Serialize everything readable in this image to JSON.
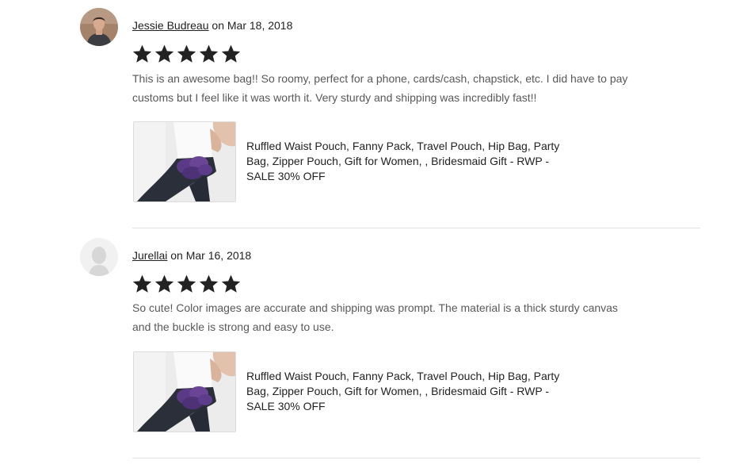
{
  "reviews": [
    {
      "author": "Jessie Budreau",
      "date_text": " on Mar 18, 2018",
      "rating": 5,
      "text": "This is an awesome bag!! So roomy, perfect for a phone, cards/cash, chapstick, etc. I did have to pay customs but I feel like it was worth it. Very sturdy and shipping was incredibly fast!!",
      "listing_title": "Ruffled Waist Pouch, Fanny Pack, Travel Pouch, Hip Bag, Party Bag, Zipper Pouch, Gift for Women, , Bridesmaid Gift - RWP - SALE 30% OFF"
    },
    {
      "author": "Jurellai",
      "date_text": " on Mar 16, 2018",
      "rating": 5,
      "text": "So cute! Color images are accurate and shipping was prompt. The material is a thick sturdy canvas and the buckle is strong and easy to use.",
      "listing_title": "Ruffled Waist Pouch, Fanny Pack, Travel Pouch, Hip Bag, Party Bag, Zipper Pouch, Gift for Women, , Bridesmaid Gift - RWP - SALE 30% OFF"
    }
  ],
  "colors": {
    "star": "#222222",
    "text_muted": "#595959",
    "divider": "#e1e1e1",
    "bag_purple": "#5a3a86"
  },
  "icons": {
    "star": "star-filled-icon",
    "default_avatar": "person-silhouette-icon"
  }
}
